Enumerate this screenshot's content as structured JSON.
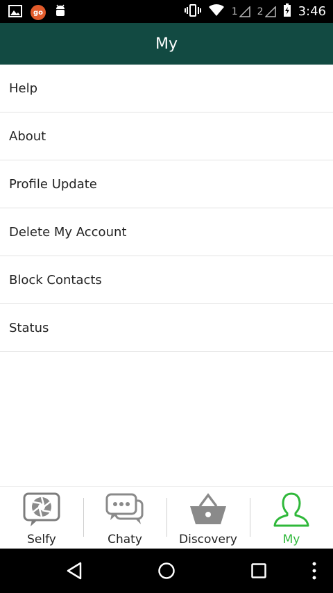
{
  "status_bar": {
    "left_icons": [
      "image-icon",
      "go-badge-icon",
      "android-icon"
    ],
    "go_badge_text": "go",
    "sim1_label": "1",
    "sim2_label": "2",
    "time": "3:46"
  },
  "header": {
    "title": "My"
  },
  "menu": {
    "items": [
      {
        "label": "Help"
      },
      {
        "label": "About"
      },
      {
        "label": "Profile Update"
      },
      {
        "label": "Delete My Account"
      },
      {
        "label": "Block Contacts"
      },
      {
        "label": "Status"
      }
    ]
  },
  "bottom_nav": {
    "active_color": "#2fb83a",
    "tabs": [
      {
        "label": "Selfy",
        "icon": "camera-shutter-icon"
      },
      {
        "label": "Chaty",
        "icon": "chat-bubbles-icon"
      },
      {
        "label": "Discovery",
        "icon": "basket-icon"
      },
      {
        "label": "My",
        "icon": "person-icon",
        "active": true
      }
    ]
  },
  "system_nav": {
    "icons": [
      "back-icon",
      "home-icon",
      "recents-icon",
      "overflow-menu-icon"
    ]
  }
}
